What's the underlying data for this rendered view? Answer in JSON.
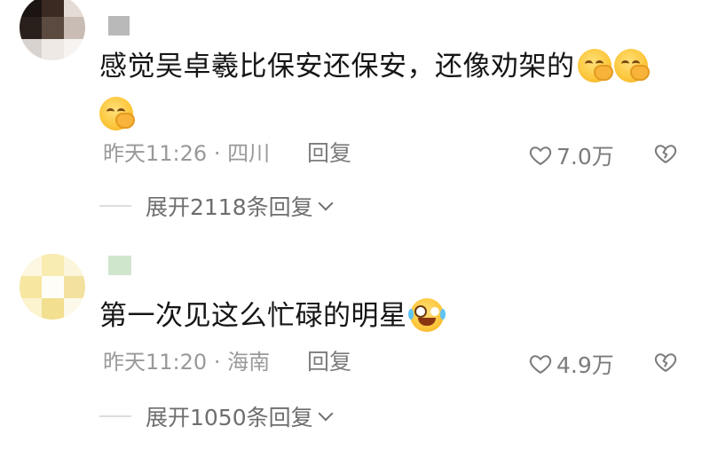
{
  "comments": [
    {
      "text": "感觉吴卓羲比保安还保安，还像劝架的",
      "emojis": [
        "smiling-hug-emoji",
        "smiling-hug-emoji",
        "smiling-hug-emoji"
      ],
      "time": "昨天11:26",
      "location": "四川",
      "reply_label": "回复",
      "likes": "7.0万",
      "expand_label": "展开2118条回复"
    },
    {
      "text": "第一次见这么忙碌的明星",
      "emojis": [
        "laugh-crying-emoji"
      ],
      "time": "昨天11:20",
      "location": "海南",
      "reply_label": "回复",
      "likes": "4.9万",
      "expand_label": "展开1050条回复"
    }
  ],
  "icons": {
    "like": "heart-outline-icon",
    "dislike": "broken-heart-outline-icon",
    "expand": "chevron-down-icon"
  },
  "colors": {
    "text": "#151515",
    "meta": "#999999",
    "action": "#7c7c7c"
  }
}
